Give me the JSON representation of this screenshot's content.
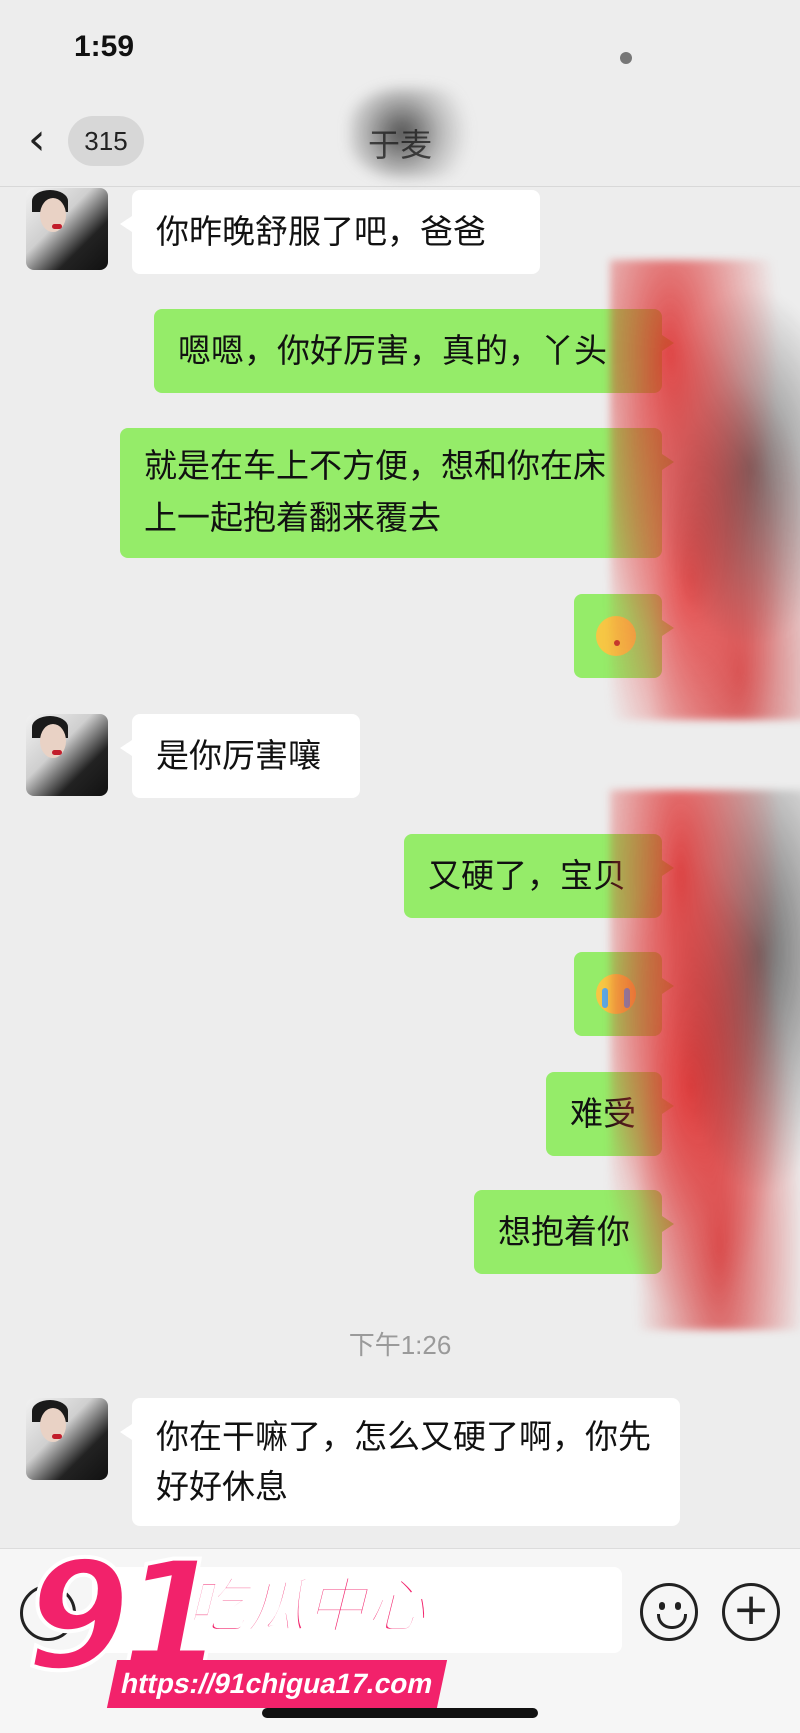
{
  "status": {
    "time": "1:59"
  },
  "nav": {
    "back_icon": "chevron-left-icon",
    "unread_count": "315",
    "title": "于麦"
  },
  "messages": [
    {
      "from": "them",
      "text": "你昨晚舒服了吧，爸爸"
    },
    {
      "from": "me",
      "text": "嗯嗯，你好厉害，真的，丫头"
    },
    {
      "from": "me",
      "text": "就是在车上不方便，想和你在床上一起抱着翻来覆去"
    },
    {
      "from": "me",
      "emoji": "kissing-face"
    },
    {
      "from": "them",
      "text": "是你厉害嚷"
    },
    {
      "from": "me",
      "text": "又硬了，宝贝"
    },
    {
      "from": "me",
      "emoji": "crying-face"
    },
    {
      "from": "me",
      "text": "难受"
    },
    {
      "from": "me",
      "text": "想抱着你"
    },
    {
      "from": "them",
      "text": "你在干嘛了，怎么又硬了啊，你先好好休息"
    }
  ],
  "timestamp": "下午1:26",
  "input_bar": {
    "voice_icon": "voice-icon",
    "emoji_icon": "smiley-icon",
    "plus_icon": "plus-icon"
  },
  "watermark": {
    "number": "91",
    "name": "吃瓜中心",
    "url": "https://91chigua17.com"
  },
  "colors": {
    "outgoing_bubble": "#95ec69",
    "incoming_bubble": "#ffffff",
    "background": "#ededed",
    "watermark": "#f2226b"
  }
}
